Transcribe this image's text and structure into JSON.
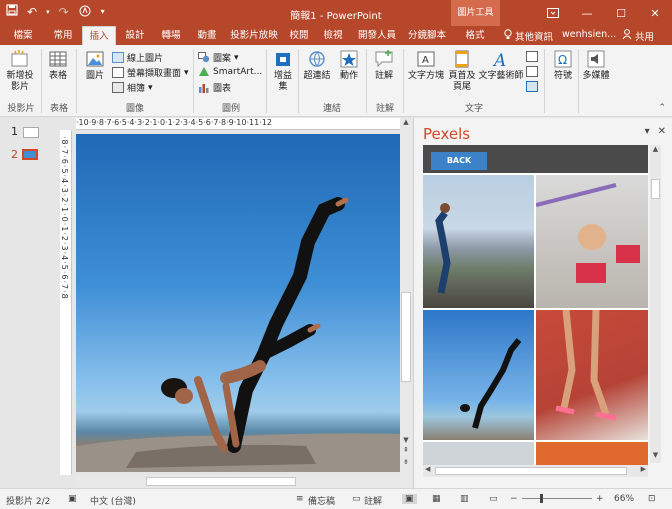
{
  "app": {
    "title": "簡報1 - PowerPoint",
    "context_group": "圖片工具"
  },
  "qat": {
    "save_icon": "save-icon",
    "undo_icon": "undo-icon",
    "redo_icon": "redo-icon",
    "customize_icon": "chevron-down-icon"
  },
  "window": {
    "ribbon_display_icon": "ribbon-display-icon",
    "minimize": "—",
    "maximize": "☐",
    "close": "✕"
  },
  "tabs": [
    "檔案",
    "常用",
    "插入",
    "設計",
    "轉場",
    "動畫",
    "投影片放映",
    "校閱",
    "檢視",
    "開發人員",
    "分鏡腳本",
    "格式"
  ],
  "tellme": "其他資訊",
  "user": "wenhsien...",
  "share": "共用",
  "ribbon": {
    "new_slide": "新增投\n影片",
    "table": "表格",
    "pictures": "圖片",
    "online_pictures": "線上圖片",
    "screenshot": "螢幕擷取畫面",
    "album": "相簿",
    "shapes": "圖案",
    "smartart": "SmartArt...",
    "chart": "圖表",
    "addins": "增益\n集",
    "hyperlink": "超連結",
    "action": "動作",
    "comment": "註解",
    "textbox": "文字方塊",
    "header_footer": "頁首及\n頁尾",
    "wordart": "文字藝術師",
    "symbol": "符號",
    "media": "多媒體",
    "groups": {
      "slides": "投影片",
      "tables": "表格",
      "images": "圖像",
      "illustrations": "圖例",
      "links": "連結",
      "comments": "註解",
      "text": "文字"
    }
  },
  "slides_panel": {
    "items": [
      {
        "number": "1"
      },
      {
        "number": "2"
      }
    ]
  },
  "ruler_h": "·10·9·8·7·6·5·4·3·2·1·0·1·2·3·4·5·6·7·8·9·10·11·12",
  "ruler_v": "·8·7·6·5·4·3·2·1·0·1·2·3·4·5·6·7·8",
  "pane": {
    "title": "Pexels",
    "back": "BACK"
  },
  "status": {
    "slide_info": "投影片 2/2",
    "language": "中文 (台灣)",
    "notes": "備忘稿",
    "comments": "註解",
    "zoom": "66%"
  },
  "colors": {
    "accent": "#b7472a",
    "pexels": "#d24726",
    "back_button": "#3b82c9"
  }
}
